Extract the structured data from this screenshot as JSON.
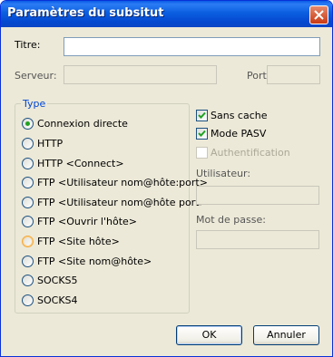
{
  "window": {
    "title": "Paramètres du subsitut"
  },
  "fields": {
    "titre": {
      "label": "Titre:",
      "value": ""
    },
    "serveur": {
      "label": "Serveur:",
      "value": ""
    },
    "port": {
      "label": "Port:",
      "value": ""
    }
  },
  "type_group": {
    "caption": "Type",
    "selected": "Connexion directe",
    "options": [
      "Connexion directe",
      "HTTP",
      "HTTP <Connect>",
      "FTP <Utilisateur nom@hôte:port>",
      "FTP <Utilisateur nom@hôte port>",
      "FTP <Ouvrir l'hôte>",
      "FTP <Site hôte>",
      "FTP <Site nom@hôte>",
      "SOCKS5",
      "SOCKS4"
    ]
  },
  "options": {
    "sans_cache": {
      "label": "Sans cache",
      "checked": true
    },
    "mode_pasv": {
      "label": "Mode PASV",
      "checked": true
    },
    "authentification": {
      "label": "Authentification",
      "checked": false,
      "enabled": false
    }
  },
  "credentials": {
    "utilisateur": {
      "label": "Utilisateur:",
      "value": ""
    },
    "mot_de_passe": {
      "label": "Mot de passe:",
      "value": ""
    }
  },
  "buttons": {
    "ok": "OK",
    "annuler": "Annuler"
  },
  "colors": {
    "titlebar": "#0b5fe0",
    "dialog_bg": "#ece9d8",
    "group_caption": "#0046d5",
    "radio_dot": "#21a121",
    "disabled_text": "#aca899"
  }
}
